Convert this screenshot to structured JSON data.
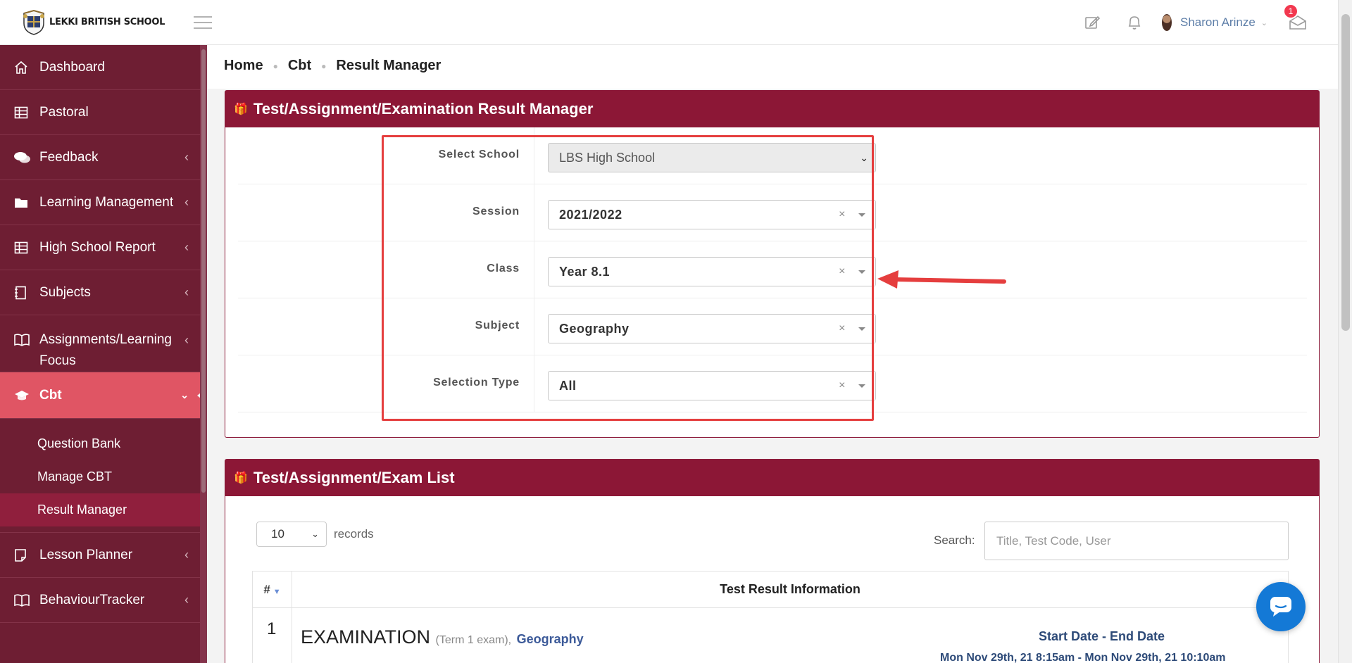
{
  "header": {
    "school_name": "LEKKI BRITISH SCHOOL",
    "user_name": "Sharon Arinze",
    "mail_badge": "1"
  },
  "sidebar": {
    "items": [
      {
        "label": "Dashboard",
        "icon": "home-icon"
      },
      {
        "label": "Pastoral",
        "icon": "table-icon"
      },
      {
        "label": "Feedback",
        "icon": "comments-icon"
      },
      {
        "label": "Learning Management",
        "icon": "folder-icon"
      },
      {
        "label": "High School Report",
        "icon": "table-icon"
      },
      {
        "label": "Subjects",
        "icon": "notebook-icon"
      },
      {
        "label": "Assignments/Learning Focus",
        "icon": "book-icon"
      },
      {
        "label": "Cbt",
        "icon": "graduation-cap-icon"
      },
      {
        "label": "Lesson Planner",
        "icon": "note-icon"
      },
      {
        "label": "BehaviourTracker",
        "icon": "book-icon"
      }
    ],
    "cbt_submenu": [
      "Question Bank",
      "Manage CBT",
      "Result Manager"
    ]
  },
  "breadcrumb": [
    "Home",
    "Cbt",
    "Result Manager"
  ],
  "result_manager": {
    "title": "Test/Assignment/Examination Result Manager",
    "fields": [
      {
        "label": "Select School",
        "value": "LBS High School"
      },
      {
        "label": "Session",
        "value": "2021/2022"
      },
      {
        "label": "Class",
        "value": "Year 8.1"
      },
      {
        "label": "Subject",
        "value": "Geography"
      },
      {
        "label": "Selection Type",
        "value": "All"
      }
    ]
  },
  "exam_list": {
    "title": "Test/Assignment/Exam List",
    "records_value": "10",
    "records_label": "records",
    "search_label": "Search:",
    "search_placeholder": "Title, Test Code, User",
    "columns": [
      "#",
      "Test Result Information"
    ],
    "rows": [
      {
        "num": "1",
        "type": "EXAMINATION",
        "term": "(Term 1 exam),",
        "subject": "Geography",
        "date_header": "Start Date - End Date",
        "date_value": "Mon Nov 29th, 21 8:15am - Mon Nov 29th, 21 10:10am"
      }
    ]
  },
  "colors": {
    "sidebar": "#6e1e33",
    "active": "#e05564",
    "card_header": "#8c1736",
    "highlight_box": "#e53e3e",
    "chat_button": "#1479d6"
  }
}
